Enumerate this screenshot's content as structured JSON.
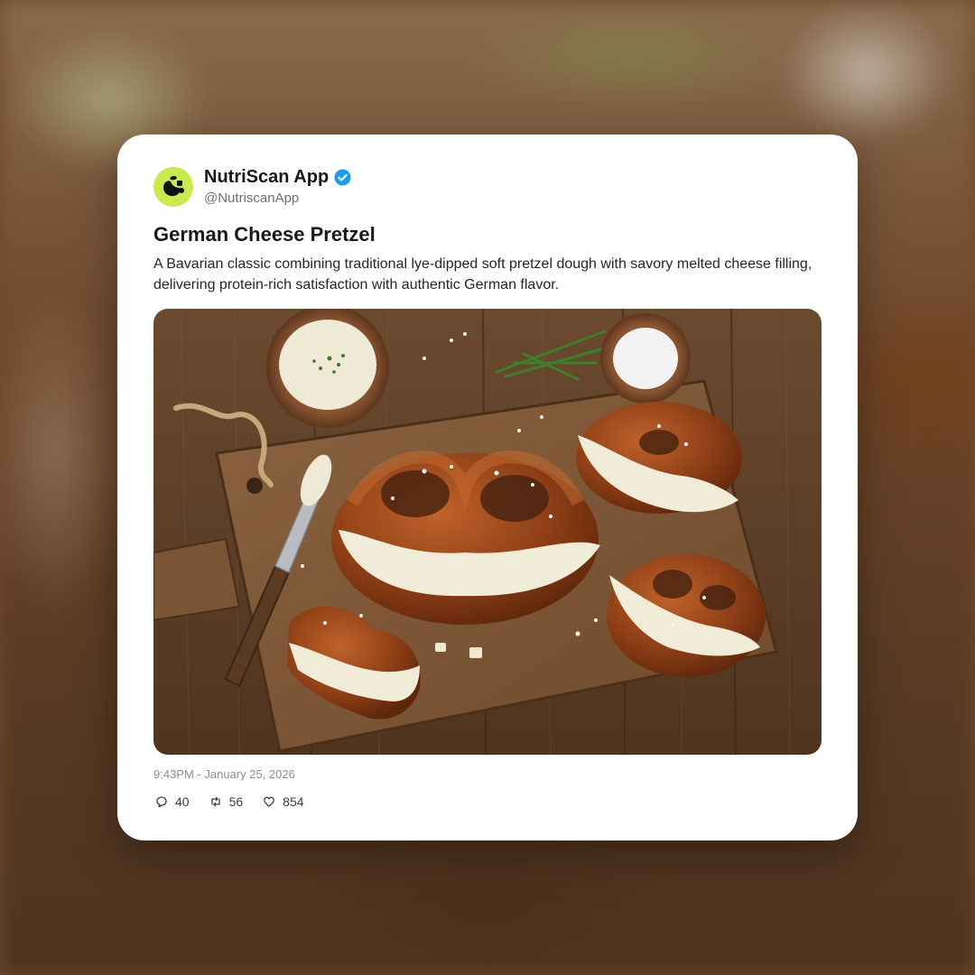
{
  "account": {
    "name": "NutriScan App",
    "handle": "@NutriscanApp",
    "avatar_color": "#c7ea4f",
    "verified_icon": "verified-badge-icon",
    "verified_color": "#1d9bf0"
  },
  "post": {
    "title": "German Cheese Pretzel",
    "description": "A Bavarian classic combining traditional lye-dipped soft pretzel dough with savory melted cheese filling, delivering protein-rich satisfaction with authentic German flavor.",
    "timestamp": "9:43PM - January 25, 2026"
  },
  "stats": {
    "replies": "40",
    "reposts": "56",
    "likes": "854",
    "reply_icon": "comment-icon",
    "repost_icon": "repost-icon",
    "like_icon": "heart-icon"
  }
}
